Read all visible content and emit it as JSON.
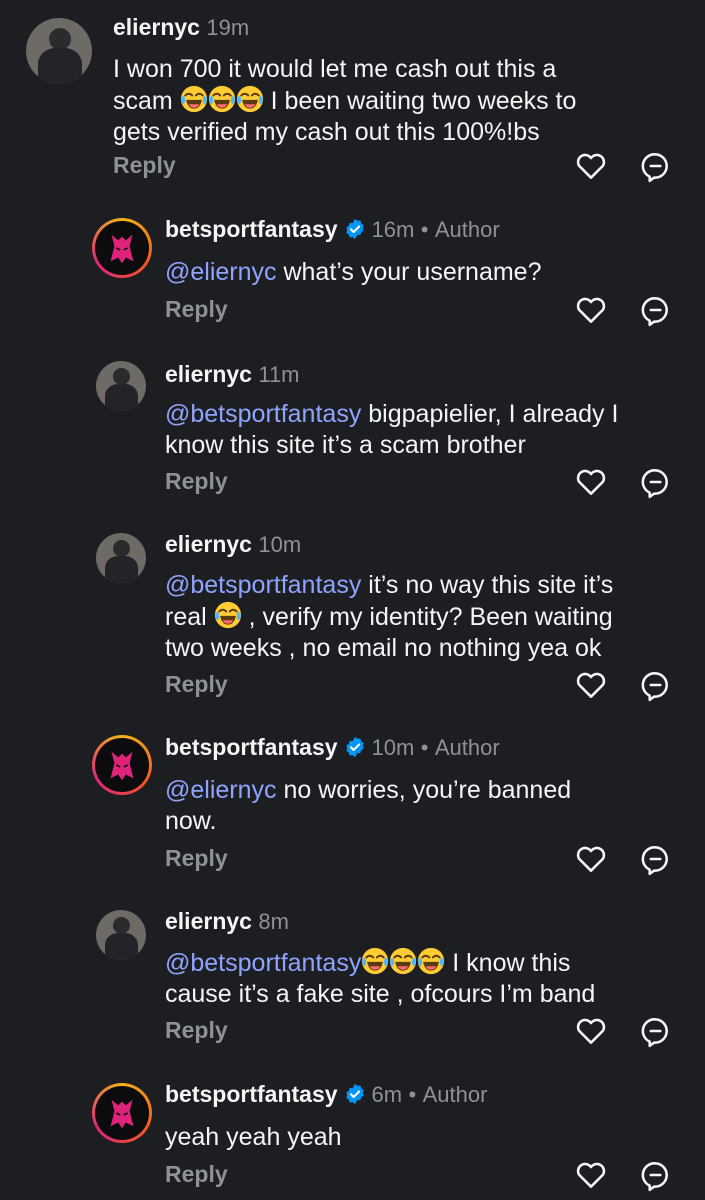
{
  "labels": {
    "reply": "Reply",
    "author": "Author",
    "dot": "•"
  },
  "comments": [
    {
      "user": "eliernyc",
      "time": "19m",
      "segs": [
        "I won 700 it would let me cash out this a ",
        "scam",
        " I been waiting two weeks to",
        "gets verified my cash out this 100%!bs"
      ]
    },
    {
      "user": "betsportfantasy",
      "time": "16m",
      "mention": "@eliernyc",
      "text": " what’s your username?"
    },
    {
      "user": "eliernyc",
      "time": "11m",
      "mention": "@betsportfantasy",
      "line1": " bigpapielier, I already I",
      "line2": "know this site it’s a scam brother"
    },
    {
      "user": "eliernyc",
      "time": "10m",
      "mention": "@betsportfantasy",
      "line1": " it’s no way this site it’s",
      "line2a": "real ",
      "line2b": " , verify my identity? Been waiting",
      "line3": "two weeks , no email no nothing yea ok"
    },
    {
      "user": "betsportfantasy",
      "time": "10m",
      "mention": "@eliernyc",
      "line1": " no worries, you’re banned",
      "line2": "now."
    },
    {
      "user": "eliernyc",
      "time": "8m",
      "mention": "@betsportfantasy",
      "line1": " I know this",
      "line2": "cause it’s a fake site , ofcours I’m band"
    },
    {
      "user": "betsportfantasy",
      "time": "6m",
      "text": "yeah yeah yeah"
    }
  ],
  "icons": {
    "like": "heart-icon",
    "share": "reply-arrow-icon",
    "verified": "verified-badge-icon",
    "emoji": "laughing-with-tears-emoji"
  },
  "colors": {
    "background": "#1c1e21",
    "mention": "#8fa4ff",
    "verified": "#0095f6",
    "muted": "#8e9196"
  }
}
